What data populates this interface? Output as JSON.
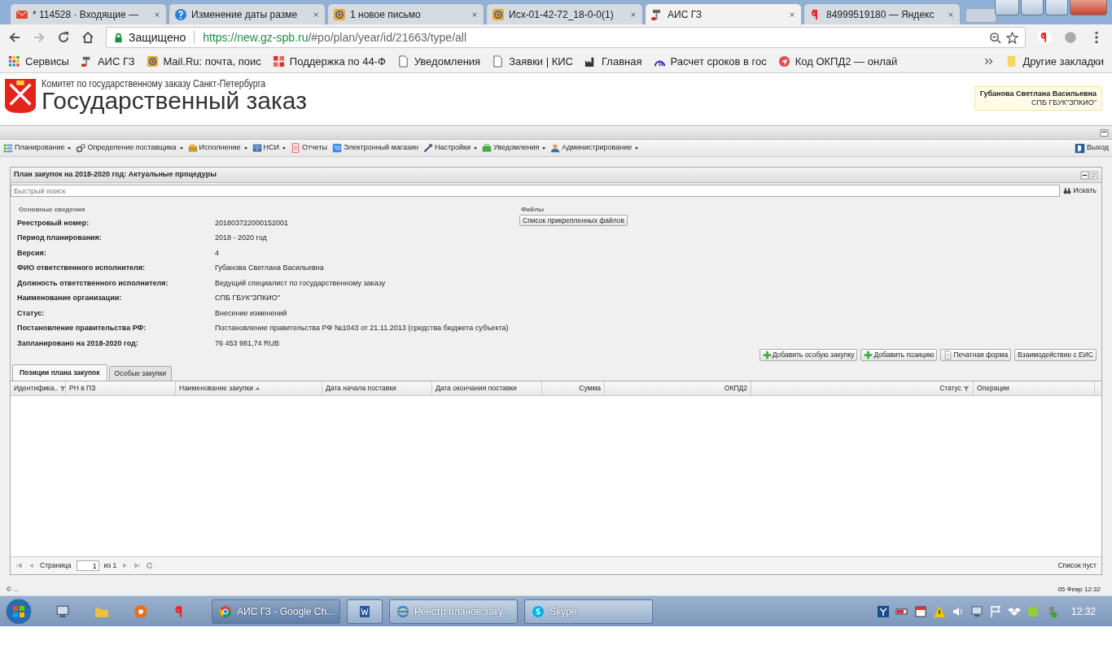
{
  "browser": {
    "tabs": [
      {
        "title": "* 114528 · Входящие —",
        "selected": false
      },
      {
        "title": "Изменение даты разме",
        "selected": false
      },
      {
        "title": "1 новое письмо",
        "selected": false
      },
      {
        "title": "Исх-01-42-72_18-0-0(1)",
        "selected": false
      },
      {
        "title": "АИС ГЗ",
        "selected": true
      },
      {
        "title": "84999519180 — Яндекс",
        "selected": false
      }
    ],
    "address": {
      "secure_label": "Защищено",
      "host": "https://new.gz-spb.ru",
      "path": "/#po/plan/year/id/21663/type/all"
    },
    "bookmarks": [
      {
        "label": "Сервисы"
      },
      {
        "label": "АИС ГЗ"
      },
      {
        "label": "Mail.Ru: почта, поис"
      },
      {
        "label": "Поддержка по 44-Ф"
      },
      {
        "label": "Уведомления"
      },
      {
        "label": "Заявки | КИС"
      },
      {
        "label": "Главная"
      },
      {
        "label": "Расчет сроков в гос"
      },
      {
        "label": "Код ОКПД2 — онлай"
      }
    ],
    "other_bookmarks": "Другие закладки"
  },
  "app": {
    "header": {
      "subtitle": "Комитет по государственному заказу Санкт-Петербурга",
      "title": "Государственный заказ",
      "user_name": "Губанова Светлана Васильевна",
      "user_org": "СПБ ГБУК\"ЗПКИО\""
    },
    "menu": [
      {
        "label": "Планирование",
        "dropdown": true
      },
      {
        "label": "Определение поставщика",
        "dropdown": true
      },
      {
        "label": "Исполнение",
        "dropdown": true
      },
      {
        "label": "НСИ",
        "dropdown": true
      },
      {
        "label": "Отчеты",
        "dropdown": false
      },
      {
        "label": "Электронный магазин",
        "dropdown": false
      },
      {
        "label": "Настройки",
        "dropdown": true
      },
      {
        "label": "Уведомления",
        "dropdown": true
      },
      {
        "label": "Администрирование",
        "dropdown": true
      }
    ],
    "logout": "Выход",
    "panel": {
      "title": "План закупок на 2018-2020 год: Актуальные процедуры",
      "search": {
        "placeholder": "Быстрый поиск",
        "button": "Искать"
      },
      "section_main": "Основные сведения",
      "fields": [
        {
          "label": "Реестровый номер:",
          "value": "201803722000152001"
        },
        {
          "label": "Период планирования:",
          "value": "2018 - 2020 год"
        },
        {
          "label": "Версия:",
          "value": "4"
        },
        {
          "label": "ФИО ответственного исполнителя:",
          "value": "Губанова Светлана Васильевна"
        },
        {
          "label": "Должность ответственного исполнителя:",
          "value": "Ведущий специалист по государственному заказу"
        },
        {
          "label": "Наименование организации:",
          "value": "СПБ ГБУК\"ЗПКИО\""
        },
        {
          "label": "Статус:",
          "value": "Внесение изменений"
        },
        {
          "label": "Постановление правительства РФ:",
          "value": "Постановление правительства РФ №1043 от 21.11.2013 (средства бюджета субъекта)"
        },
        {
          "label": "Запланировано на 2018-2020 год:",
          "value": "76 453 981,74 RUB"
        }
      ],
      "section_files": "Файлы",
      "files_button": "Список прикрепленных файлов",
      "actions": [
        "Добавить особую закупку",
        "Добавить позицию",
        "Печатная форма",
        "Взаимодействие с ЕИС"
      ],
      "tabs": [
        {
          "label": "Позиции плана закупок",
          "selected": true
        },
        {
          "label": "Особые закупки",
          "selected": false
        }
      ],
      "columns": [
        {
          "label": "Идентифика..",
          "sorted": false,
          "filter": true
        },
        {
          "label": "РН в ПЗ",
          "sorted": false,
          "filter": false
        },
        {
          "label": "Наименование закупки",
          "sorted": true,
          "filter": false
        },
        {
          "label": "Дата начала поставки",
          "sorted": false,
          "filter": false
        },
        {
          "label": "Дата окончания поставки",
          "sorted": false,
          "filter": false
        },
        {
          "label": "Сумма",
          "sorted": false,
          "filter": false
        },
        {
          "label": "ОКПД2",
          "sorted": false,
          "filter": false
        },
        {
          "label": "Статус",
          "sorted": false,
          "filter": true
        },
        {
          "label": "Операции",
          "sorted": false,
          "filter": false
        }
      ],
      "paging": {
        "page_label": "Страница",
        "page": "1",
        "of": "из 1",
        "empty": "Список пуст"
      }
    },
    "status_bar": {
      "left": "© ...",
      "right": "05 Февр 12:32"
    }
  },
  "taskbar": {
    "tasks": [
      {
        "label": "АИС ГЗ - Google Ch...",
        "selected": true
      },
      {
        "selected": false
      },
      {
        "label": "Реестр планов заку...",
        "selected": false
      },
      {
        "label": "Skype",
        "selected": false
      }
    ],
    "clock": "12:32"
  }
}
